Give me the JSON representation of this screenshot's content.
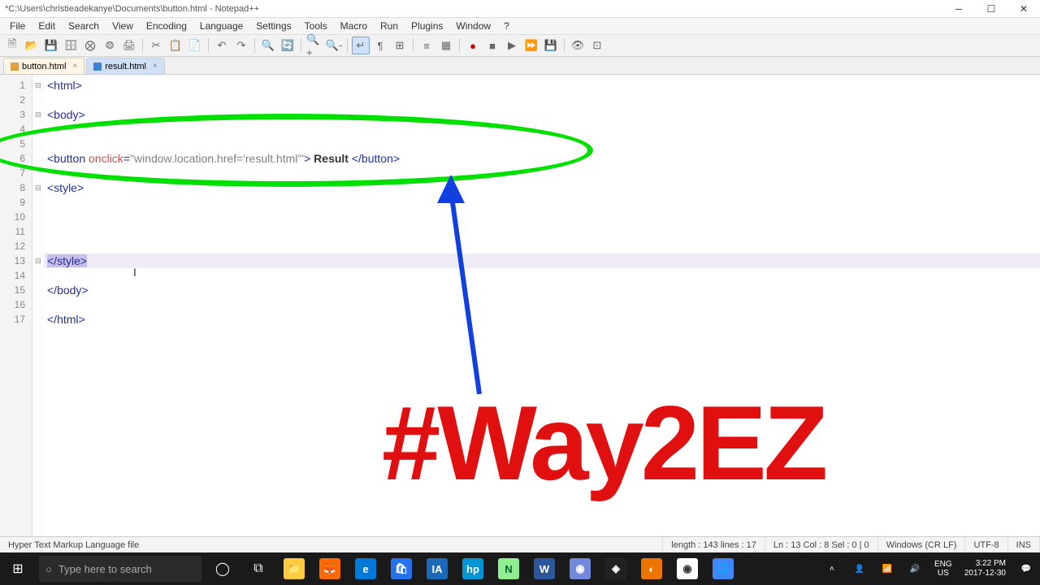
{
  "titlebar": {
    "path": "*C:\\Users\\christieadekanye\\Documents\\button.html - Notepad++"
  },
  "menu": [
    "File",
    "Edit",
    "Search",
    "View",
    "Encoding",
    "Language",
    "Settings",
    "Tools",
    "Macro",
    "Run",
    "Plugins",
    "Window",
    "?"
  ],
  "tabs": [
    {
      "label": "button.html",
      "active": true
    },
    {
      "label": "result.html",
      "active": false
    }
  ],
  "gutter": [
    "1",
    "2",
    "3",
    "4",
    "5",
    "6",
    "7",
    "8",
    "9",
    "10",
    "11",
    "12",
    "13",
    "14",
    "15",
    "16",
    "17"
  ],
  "fold": [
    "⊟",
    "",
    "⊟",
    "",
    "",
    "",
    "",
    "⊟",
    "",
    "",
    "",
    "",
    "⊟",
    "",
    "",
    "",
    ""
  ],
  "code": {
    "l1": "<html>",
    "l3": "<body>",
    "l6_tag_open": "<button ",
    "l6_attr": "onclick",
    "l6_eq": "=",
    "l6_str": "\"window.location.href='result.html'\"",
    "l6_close": ">",
    "l6_text": " Result ",
    "l6_end": "</button>",
    "l8": "<style>",
    "l13": "</style>",
    "l15": "</body>",
    "l17": "</html>"
  },
  "annotation": {
    "text": "#Way2EZ"
  },
  "status": {
    "filetype": "Hyper Text Markup Language file",
    "length": "length : 143    lines : 17",
    "pos": "Ln : 13    Col : 8    Sel : 0 | 0",
    "eol": "Windows (CR LF)",
    "enc": "UTF-8",
    "mode": "INS"
  },
  "taskbar": {
    "search": "Type here to search",
    "lang1": "ENG",
    "lang2": "US",
    "time": "3:22 PM",
    "date": "2017-12-30"
  }
}
